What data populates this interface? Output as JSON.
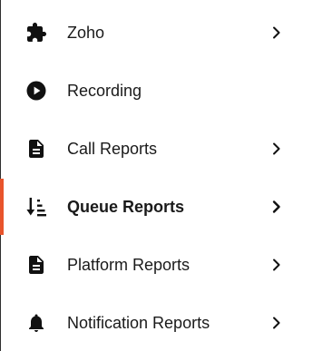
{
  "nav": {
    "accent_color": "#e8542c",
    "items": [
      {
        "label": "Zoho",
        "icon": "puzzle-piece-icon",
        "has_chevron": true,
        "active": false
      },
      {
        "label": "Recording",
        "icon": "play-circle-icon",
        "has_chevron": false,
        "active": false
      },
      {
        "label": "Call Reports",
        "icon": "document-icon",
        "has_chevron": true,
        "active": false
      },
      {
        "label": "Queue Reports",
        "icon": "sort-descending-icon",
        "has_chevron": true,
        "active": true
      },
      {
        "label": "Platform Reports",
        "icon": "document-icon",
        "has_chevron": true,
        "active": false
      },
      {
        "label": "Notification Reports",
        "icon": "bell-icon",
        "has_chevron": true,
        "active": false
      }
    ]
  }
}
